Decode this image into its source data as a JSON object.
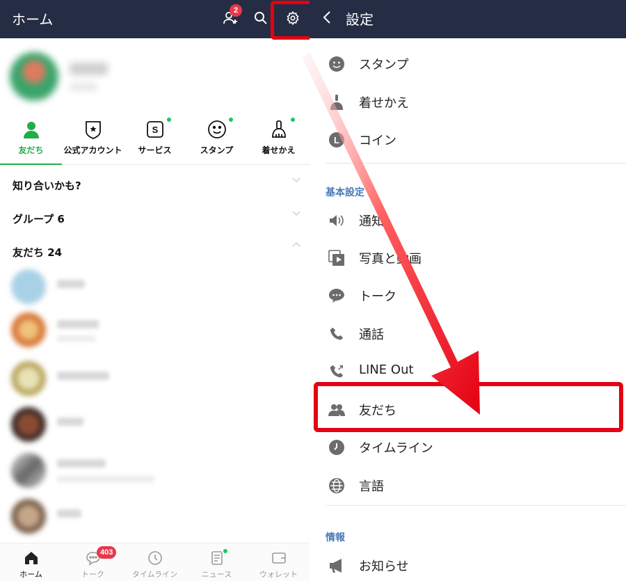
{
  "left": {
    "header": {
      "title": "ホーム",
      "add_friend_badge": "2"
    },
    "tabs": [
      {
        "label": "友だち",
        "icon": "person-icon"
      },
      {
        "label": "公式アカウント",
        "icon": "badge-icon"
      },
      {
        "label": "サービス",
        "icon": "service-icon"
      },
      {
        "label": "スタンプ",
        "icon": "smiley-icon"
      },
      {
        "label": "着せかえ",
        "icon": "brush-icon"
      }
    ],
    "sections": [
      {
        "label": "知り合いかも?"
      },
      {
        "label": "グループ 6"
      },
      {
        "label": "友だち 24"
      }
    ],
    "bottom_nav": [
      {
        "label": "ホーム",
        "icon": "home-icon"
      },
      {
        "label": "トーク",
        "icon": "chat-icon",
        "badge": "403"
      },
      {
        "label": "タイムライン",
        "icon": "clock-icon"
      },
      {
        "label": "ニュース",
        "icon": "news-icon"
      },
      {
        "label": "ウォレット",
        "icon": "wallet-icon"
      }
    ]
  },
  "right": {
    "header": {
      "title": "設定"
    },
    "items_top": [
      {
        "label": "スタンプ",
        "icon": "smiley-icon"
      },
      {
        "label": "着せかえ",
        "icon": "brush-icon"
      },
      {
        "label": "コイン",
        "icon": "coin-icon"
      }
    ],
    "section_basic": "基本設定",
    "items_basic": [
      {
        "label": "通知",
        "icon": "speaker-icon"
      },
      {
        "label": "写真と動画",
        "icon": "photo-video-icon"
      },
      {
        "label": "トーク",
        "icon": "chat-bubble-icon"
      },
      {
        "label": "通話",
        "icon": "phone-icon"
      },
      {
        "label": "LINE Out",
        "icon": "phone-out-icon"
      },
      {
        "label": "友だち",
        "icon": "friends-icon"
      },
      {
        "label": "タイムライン",
        "icon": "clock-icon"
      },
      {
        "label": "言語",
        "icon": "globe-icon"
      }
    ],
    "section_info": "情報",
    "items_info": [
      {
        "label": "お知らせ",
        "icon": "megaphone-icon"
      }
    ]
  },
  "colors": {
    "header_bg": "#252d44",
    "accent_green": "#1fae4a",
    "highlight_red": "#e50012",
    "section_blue": "#4a7ab8",
    "badge_red": "#e8384b"
  }
}
